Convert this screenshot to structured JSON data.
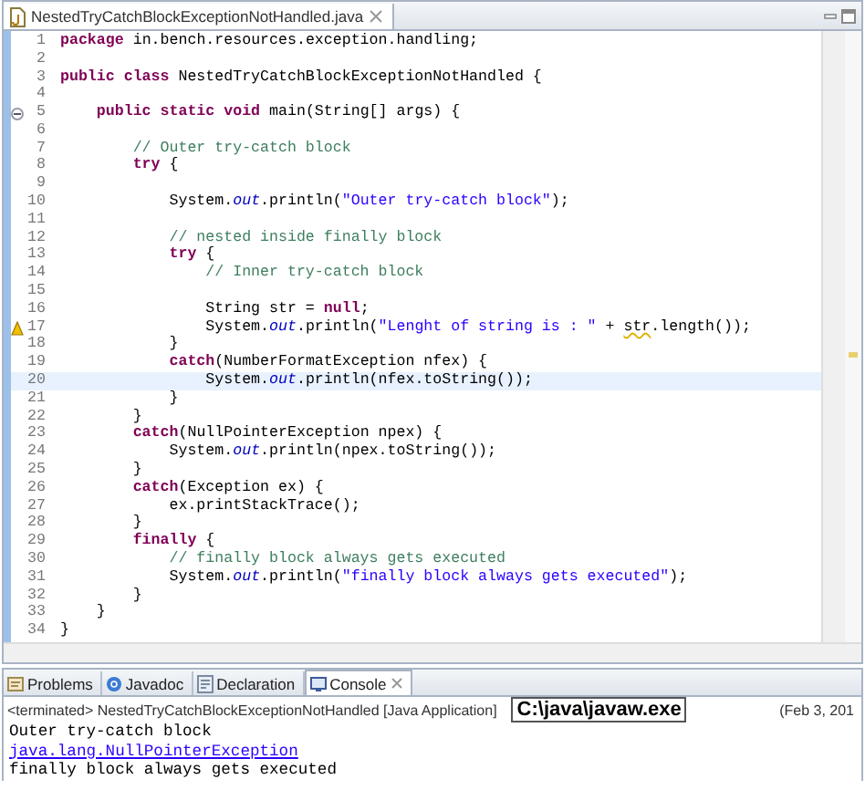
{
  "editor": {
    "tab": {
      "title": "NestedTryCatchBlockExceptionNotHandled.java",
      "selected": true
    },
    "lines": [
      {
        "number": "1",
        "kind": "plain",
        "current": false,
        "tokens": [
          {
            "kind": "kw",
            "t": "package"
          },
          {
            "kind": "plain",
            "t": " in.bench.resources.exception.handling;"
          }
        ]
      },
      {
        "number": "2",
        "kind": "plain",
        "current": false
      },
      {
        "number": "3",
        "kind": "plain",
        "current": false,
        "tokens": [
          {
            "kind": "kw",
            "t": "public class"
          },
          {
            "kind": "plain",
            "t": " NestedTryCatchBlockExceptionNotHandled {"
          }
        ]
      },
      {
        "number": "4",
        "kind": "plain",
        "current": false
      },
      {
        "number": "5",
        "kind": "fold",
        "current": false,
        "tokens": [
          {
            "kind": "kw",
            "t": "    public static void"
          },
          {
            "kind": "plain",
            "t": " main(String[] args) {"
          }
        ]
      },
      {
        "number": "6",
        "kind": "plain",
        "current": false
      },
      {
        "number": "7",
        "kind": "plain",
        "current": false,
        "tokens": [
          {
            "kind": "comment",
            "t": "        // Outer try-catch block"
          }
        ]
      },
      {
        "number": "8",
        "kind": "plain",
        "current": false,
        "tokens": [
          {
            "kind": "kw",
            "t": "        try"
          },
          {
            "kind": "plain",
            "t": " {"
          }
        ]
      },
      {
        "number": "9",
        "kind": "plain",
        "current": false
      },
      {
        "number": "10",
        "kind": "plain",
        "current": false,
        "tokens": [
          {
            "kind": "plain",
            "t": "            System."
          },
          {
            "kind": "field",
            "t": "out"
          },
          {
            "kind": "plain",
            "t": ".println("
          },
          {
            "kind": "string",
            "t": "\"Outer try-catch block\""
          },
          {
            "kind": "plain",
            "t": ");"
          }
        ]
      },
      {
        "number": "11",
        "kind": "plain",
        "current": false
      },
      {
        "number": "12",
        "kind": "plain",
        "current": false,
        "tokens": [
          {
            "kind": "comment",
            "t": "            // nested inside finally block"
          }
        ]
      },
      {
        "number": "13",
        "kind": "plain",
        "current": false,
        "tokens": [
          {
            "kind": "kw",
            "t": "            try"
          },
          {
            "kind": "plain",
            "t": " {"
          }
        ]
      },
      {
        "number": "14",
        "kind": "plain",
        "current": false,
        "tokens": [
          {
            "kind": "comment",
            "t": "                // Inner try-catch block"
          }
        ]
      },
      {
        "number": "15",
        "kind": "plain",
        "current": false
      },
      {
        "number": "16",
        "kind": "plain",
        "current": false,
        "tokens": [
          {
            "kind": "plain",
            "t": "                String str = "
          },
          {
            "kind": "kw",
            "t": "null"
          },
          {
            "kind": "plain",
            "t": ";"
          }
        ]
      },
      {
        "number": "17",
        "kind": "warning",
        "current": false,
        "tokens": [
          {
            "kind": "plain",
            "t": "                System."
          },
          {
            "kind": "field",
            "t": "out"
          },
          {
            "kind": "plain",
            "t": ".println("
          },
          {
            "kind": "string",
            "t": "\"Lenght of string is : \""
          },
          {
            "kind": "plain",
            "t": " + "
          },
          {
            "kind": "warn",
            "t": "str"
          },
          {
            "kind": "plain",
            "t": ".length());"
          }
        ]
      },
      {
        "number": "18",
        "kind": "plain",
        "current": false,
        "tokens": [
          {
            "kind": "plain",
            "t": "            }"
          }
        ]
      },
      {
        "number": "19",
        "kind": "plain",
        "current": false,
        "tokens": [
          {
            "kind": "kw",
            "t": "            catch"
          },
          {
            "kind": "plain",
            "t": "(NumberFormatException nfex) {"
          }
        ]
      },
      {
        "number": "20",
        "kind": "plain",
        "current": true,
        "tokens": [
          {
            "kind": "plain",
            "t": "                System."
          },
          {
            "kind": "field",
            "t": "out"
          },
          {
            "kind": "plain",
            "t": ".println(nfex.toString());"
          }
        ]
      },
      {
        "number": "21",
        "kind": "plain",
        "current": false,
        "tokens": [
          {
            "kind": "plain",
            "t": "            }"
          }
        ]
      },
      {
        "number": "22",
        "kind": "plain",
        "current": false,
        "tokens": [
          {
            "kind": "plain",
            "t": "        }"
          }
        ]
      },
      {
        "number": "23",
        "kind": "plain",
        "current": false,
        "tokens": [
          {
            "kind": "kw",
            "t": "        catch"
          },
          {
            "kind": "plain",
            "t": "(NullPointerException npex) {"
          }
        ]
      },
      {
        "number": "24",
        "kind": "plain",
        "current": false,
        "tokens": [
          {
            "kind": "plain",
            "t": "            System."
          },
          {
            "kind": "field",
            "t": "out"
          },
          {
            "kind": "plain",
            "t": ".println(npex.toString());"
          }
        ]
      },
      {
        "number": "25",
        "kind": "plain",
        "current": false,
        "tokens": [
          {
            "kind": "plain",
            "t": "        }"
          }
        ]
      },
      {
        "number": "26",
        "kind": "plain",
        "current": false,
        "tokens": [
          {
            "kind": "kw",
            "t": "        catch"
          },
          {
            "kind": "plain",
            "t": "(Exception ex) {"
          }
        ]
      },
      {
        "number": "27",
        "kind": "plain",
        "current": false,
        "tokens": [
          {
            "kind": "plain",
            "t": "            ex.printStackTrace();"
          }
        ]
      },
      {
        "number": "28",
        "kind": "plain",
        "current": false,
        "tokens": [
          {
            "kind": "plain",
            "t": "        }"
          }
        ]
      },
      {
        "number": "29",
        "kind": "plain",
        "current": false,
        "tokens": [
          {
            "kind": "kw",
            "t": "        finally"
          },
          {
            "kind": "plain",
            "t": " {"
          }
        ]
      },
      {
        "number": "30",
        "kind": "plain",
        "current": false,
        "tokens": [
          {
            "kind": "comment",
            "t": "            // finally block always gets executed"
          }
        ]
      },
      {
        "number": "31",
        "kind": "plain",
        "current": false,
        "tokens": [
          {
            "kind": "plain",
            "t": "            System."
          },
          {
            "kind": "field",
            "t": "out"
          },
          {
            "kind": "plain",
            "t": ".println("
          },
          {
            "kind": "string",
            "t": "\"finally block always gets executed\""
          },
          {
            "kind": "plain",
            "t": ");"
          }
        ]
      },
      {
        "number": "32",
        "kind": "plain",
        "current": false,
        "tokens": [
          {
            "kind": "plain",
            "t": "        }"
          }
        ]
      },
      {
        "number": "33",
        "kind": "plain",
        "current": false,
        "tokens": [
          {
            "kind": "plain",
            "t": "    }"
          }
        ]
      },
      {
        "number": "34",
        "kind": "plain",
        "current": false,
        "tokens": [
          {
            "kind": "plain",
            "t": "}"
          }
        ]
      }
    ]
  },
  "console": {
    "tabs": [
      {
        "kind": "problems",
        "label": "Problems",
        "selected": false
      },
      {
        "kind": "javadoc",
        "label": "Javadoc",
        "selected": false
      },
      {
        "kind": "declaration",
        "label": "Declaration",
        "selected": false
      },
      {
        "kind": "console",
        "label": "Console",
        "selected": true
      }
    ],
    "status": "<terminated> NestedTryCatchBlockExceptionNotHandled [Java Application]",
    "path": "C:\\java\\javaw.exe",
    "date": "(Feb 3, 201",
    "output": [
      {
        "kind": "text",
        "t": "Outer try-catch block"
      },
      {
        "kind": "link",
        "t": "java.lang.NullPointerException"
      },
      {
        "kind": "text",
        "t": "finally block always gets executed"
      }
    ]
  }
}
